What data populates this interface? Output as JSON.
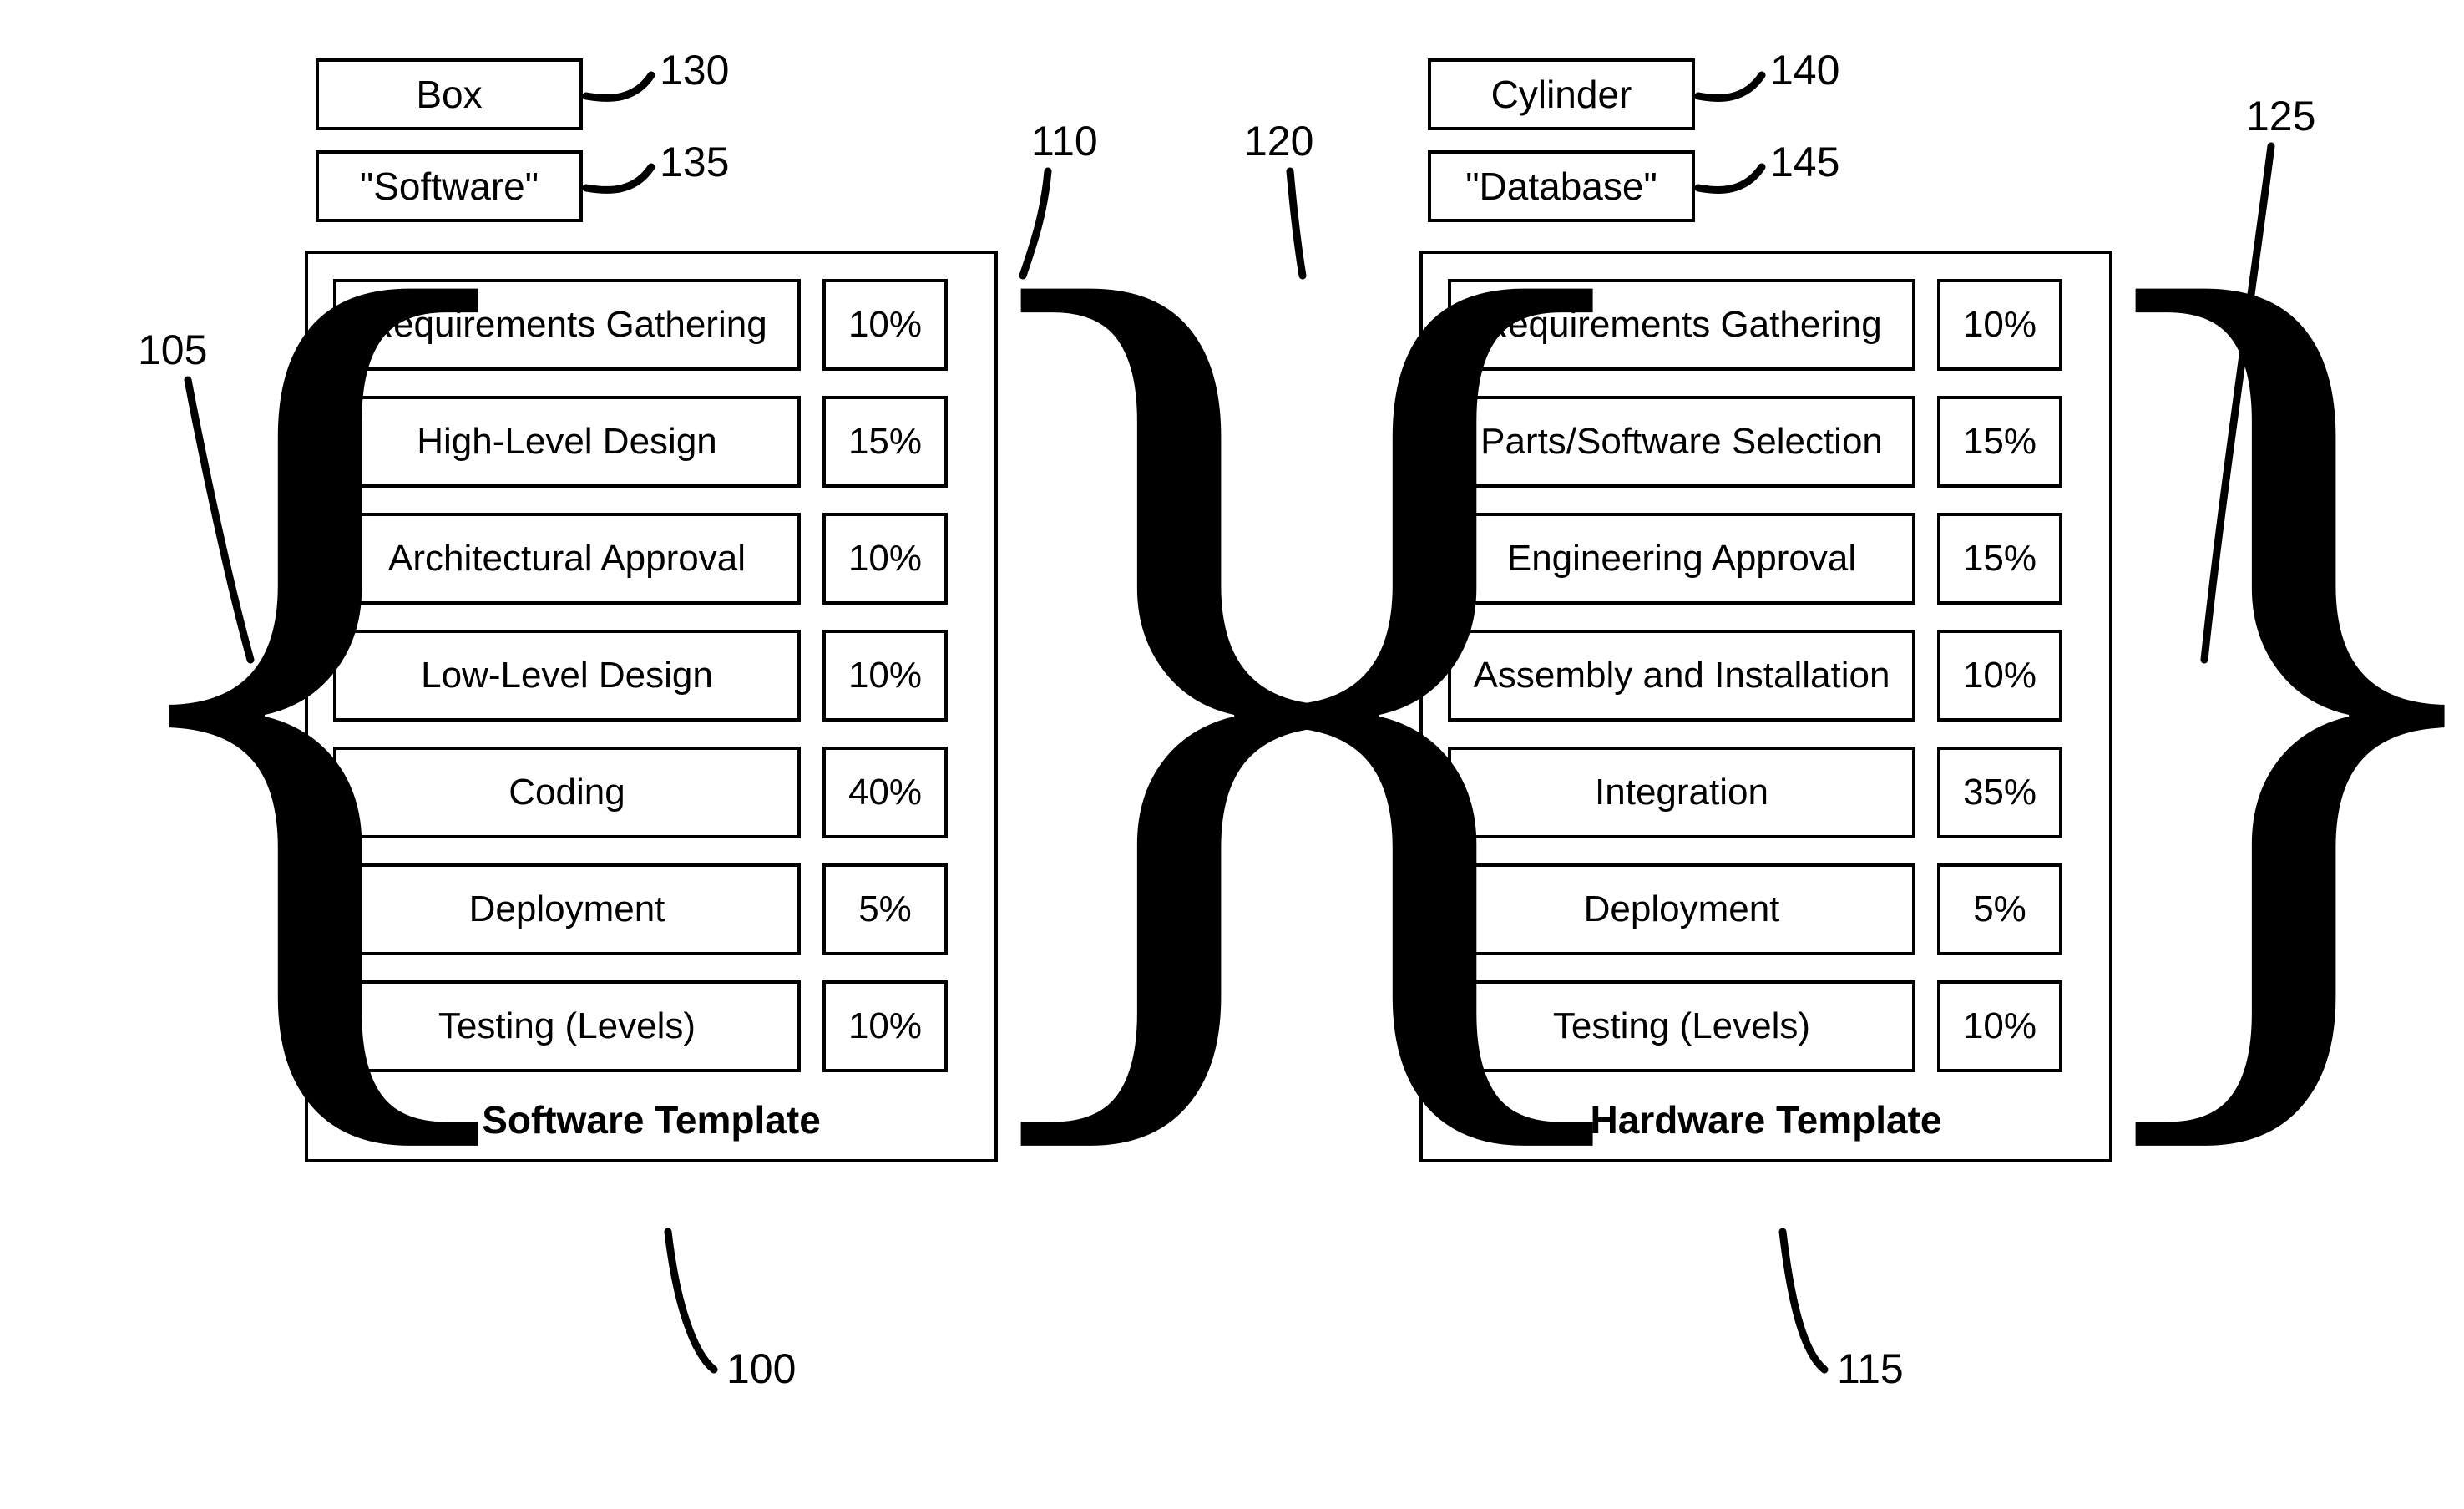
{
  "left": {
    "tag_shape": "Box",
    "tag_name": "\"Software\"",
    "caption": "Software Template",
    "tasks": [
      {
        "name": "Requirements Gathering",
        "pct": "10%"
      },
      {
        "name": "High-Level Design",
        "pct": "15%"
      },
      {
        "name": "Architectural Approval",
        "pct": "10%"
      },
      {
        "name": "Low-Level Design",
        "pct": "10%"
      },
      {
        "name": "Coding",
        "pct": "40%"
      },
      {
        "name": "Deployment",
        "pct": "5%"
      },
      {
        "name": "Testing (Levels)",
        "pct": "10%"
      }
    ]
  },
  "right": {
    "tag_shape": "Cylinder",
    "tag_name": "\"Database\"",
    "caption": "Hardware Template",
    "tasks": [
      {
        "name": "Requirements Gathering",
        "pct": "10%"
      },
      {
        "name": "Parts/Software Selection",
        "pct": "15%"
      },
      {
        "name": "Engineering Approval",
        "pct": "15%"
      },
      {
        "name": "Assembly and Installation",
        "pct": "10%"
      },
      {
        "name": "Integration",
        "pct": "35%"
      },
      {
        "name": "Deployment",
        "pct": "5%"
      },
      {
        "name": "Testing (Levels)",
        "pct": "10%"
      }
    ]
  },
  "refs": {
    "r130": "130",
    "r135": "135",
    "r110": "110",
    "r105": "105",
    "r100": "100",
    "r140": "140",
    "r145": "145",
    "r120": "120",
    "r125": "125",
    "r115": "115"
  }
}
